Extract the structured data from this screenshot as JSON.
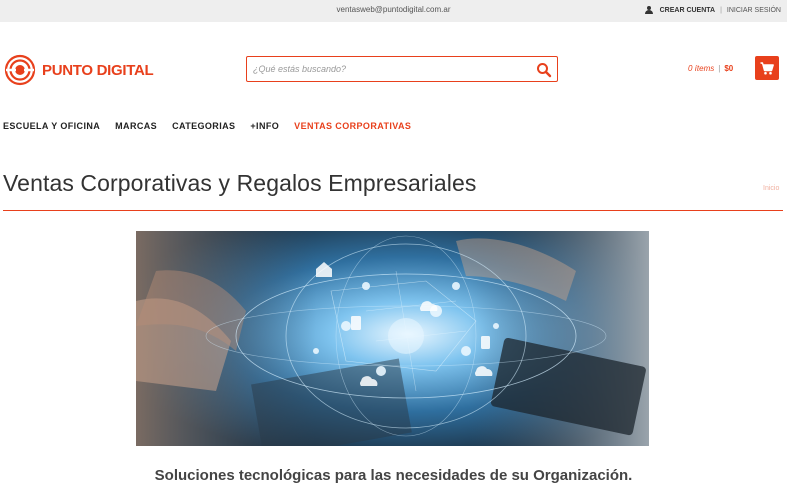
{
  "topbar": {
    "email": "ventasweb@puntodigital.com.ar",
    "create_account": "CREAR CUENTA",
    "login": "INICIAR SESIÓN",
    "user_icon": "user-icon"
  },
  "logo": {
    "text": "PUNTO DIGITAL",
    "brand_color": "#e8401c"
  },
  "search": {
    "placeholder": "¿Qué estás buscando?",
    "icon": "search-icon"
  },
  "cart": {
    "items_label": "0 ítems",
    "separator": "|",
    "total": "$0",
    "icon": "shopping-cart-icon"
  },
  "nav": {
    "items": [
      {
        "label": "ESCUELA Y OFICINA"
      },
      {
        "label": "MARCAS"
      },
      {
        "label": "CATEGORIAS"
      },
      {
        "label": "+INFO"
      },
      {
        "label": "VENTAS CORPORATIVAS"
      }
    ]
  },
  "page": {
    "title": "Ventas Corporativas y Regalos Empresariales",
    "breadcrumb": "Inicio",
    "tagline": "Soluciones tecnológicas para las necesidades de su Organización."
  },
  "colors": {
    "accent": "#e8401c",
    "topbar_bg": "#eeeeee",
    "text": "#333333"
  }
}
